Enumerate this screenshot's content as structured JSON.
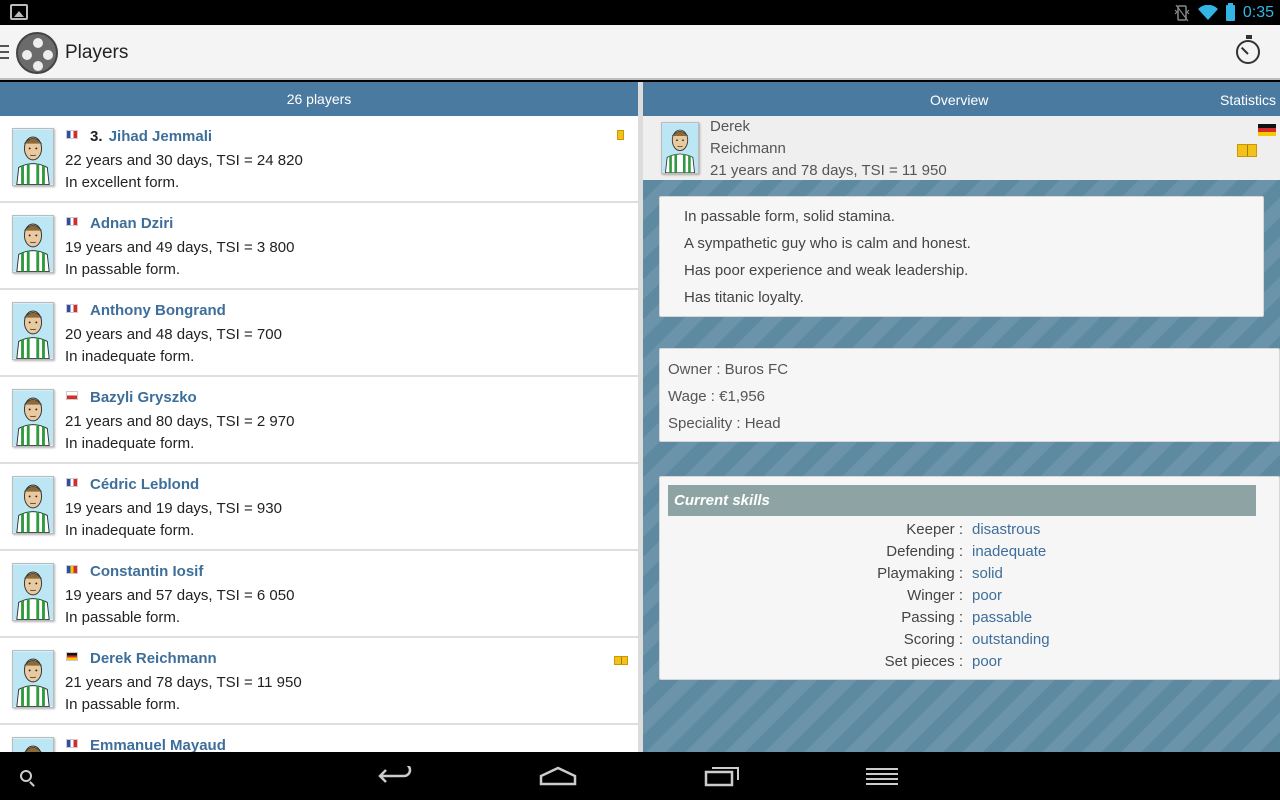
{
  "status_bar": {
    "time": "0:35"
  },
  "app_bar": {
    "title": "Players"
  },
  "player_list": {
    "header": "26 players",
    "players": [
      {
        "number": "3.",
        "name": "Jihad Jemmali",
        "age_tsi": "22 years and 30 days, TSI = 24 820",
        "form": "In excellent form.",
        "flag": "fr",
        "badge": "yellow-card"
      },
      {
        "number": "",
        "name": "Adnan Dziri",
        "age_tsi": "19 years and 49 days, TSI = 3 800",
        "form": "In passable form.",
        "flag": "fr",
        "badge": ""
      },
      {
        "number": "",
        "name": "Anthony Bongrand",
        "age_tsi": "20 years and 48 days, TSI = 700",
        "form": "In inadequate form.",
        "flag": "fr",
        "badge": ""
      },
      {
        "number": "",
        "name": "Bazyli Gryszko",
        "age_tsi": "21 years and 80 days, TSI = 2 970",
        "form": "In inadequate form.",
        "flag": "pl",
        "badge": ""
      },
      {
        "number": "",
        "name": "Cédric Leblond",
        "age_tsi": "19 years and 19 days, TSI = 930",
        "form": "In inadequate form.",
        "flag": "fr",
        "badge": ""
      },
      {
        "number": "",
        "name": "Constantin Iosif",
        "age_tsi": "19 years and 57 days, TSI = 6 050",
        "form": "In passable form.",
        "flag": "ro",
        "badge": ""
      },
      {
        "number": "",
        "name": "Derek Reichmann",
        "age_tsi": "21 years and 78 days, TSI = 11 950",
        "form": "In passable form.",
        "flag": "de",
        "badge": "book"
      },
      {
        "number": "",
        "name": "Emmanuel Mayaud",
        "age_tsi": "",
        "form": "",
        "flag": "fr",
        "badge": ""
      }
    ]
  },
  "detail": {
    "tabs": {
      "overview": "Overview",
      "statistics": "Statistics"
    },
    "first_name": "Derek",
    "last_name": "Reichmann",
    "age_tsi": "21 years and 78 days, TSI = 11 950",
    "flag": "de",
    "description": [
      "In passable form, solid stamina.",
      "A sympathetic guy who is calm and honest.",
      "Has poor experience and weak leadership.",
      "Has titanic loyalty."
    ],
    "owner": "Owner : Buros FC",
    "wage": "Wage : €1,956",
    "speciality": "Speciality : Head",
    "skills_title": "Current skills",
    "skills": [
      {
        "label": "Keeper :",
        "value": "disastrous"
      },
      {
        "label": "Defending :",
        "value": "inadequate"
      },
      {
        "label": "Playmaking :",
        "value": "solid"
      },
      {
        "label": "Winger :",
        "value": "poor"
      },
      {
        "label": "Passing :",
        "value": "passable"
      },
      {
        "label": "Scoring :",
        "value": "outstanding"
      },
      {
        "label": "Set pieces :",
        "value": "poor"
      }
    ]
  },
  "colors": {
    "header_blue": "#4b7aa0",
    "link_blue": "#3e6e9a",
    "status_accent": "#33b5e5",
    "skills_header": "#8ea4a4"
  }
}
